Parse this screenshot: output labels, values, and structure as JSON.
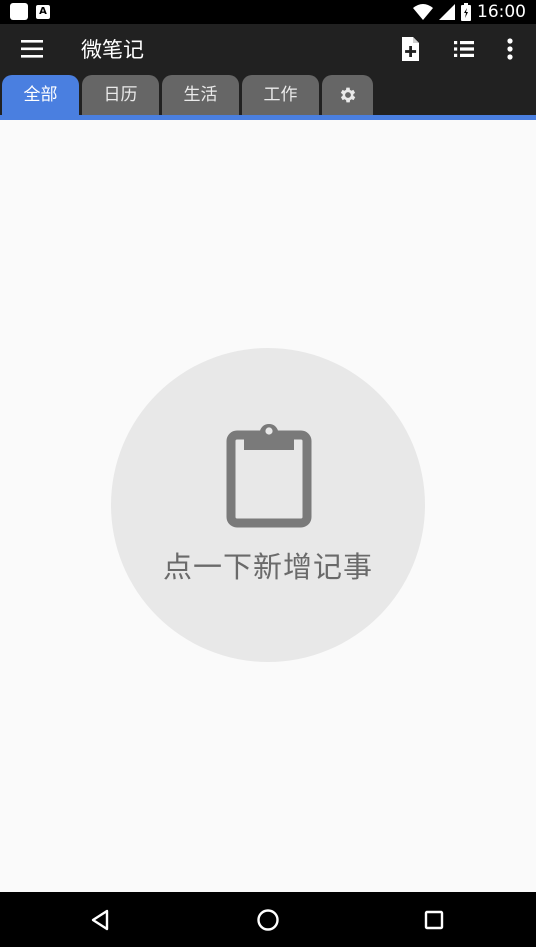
{
  "status_bar": {
    "time": "16:00",
    "icons": [
      "notification-square-icon",
      "a-icon",
      "wifi-icon",
      "signal-icon",
      "battery-icon"
    ]
  },
  "toolbar": {
    "title": "微笔记",
    "icons": [
      "menu-icon",
      "new-note-icon",
      "list-view-icon",
      "more-icon"
    ]
  },
  "tabs": [
    {
      "label": "全部",
      "active": true
    },
    {
      "label": "日历",
      "active": false
    },
    {
      "label": "生活",
      "active": false
    },
    {
      "label": "工作",
      "active": false
    },
    {
      "label": "",
      "icon": "gear-icon",
      "active": false
    }
  ],
  "empty_state": {
    "icon": "clipboard-icon",
    "text": "点一下新增记事"
  },
  "nav_bar": {
    "icons": [
      "back-icon",
      "home-icon",
      "recents-icon"
    ]
  },
  "colors": {
    "accent": "#4a7fe0",
    "toolbar": "#212121",
    "tab_inactive": "#666666",
    "background": "#fafafa",
    "empty_circle": "#e8e8e8",
    "empty_text": "#6a6a6a"
  }
}
